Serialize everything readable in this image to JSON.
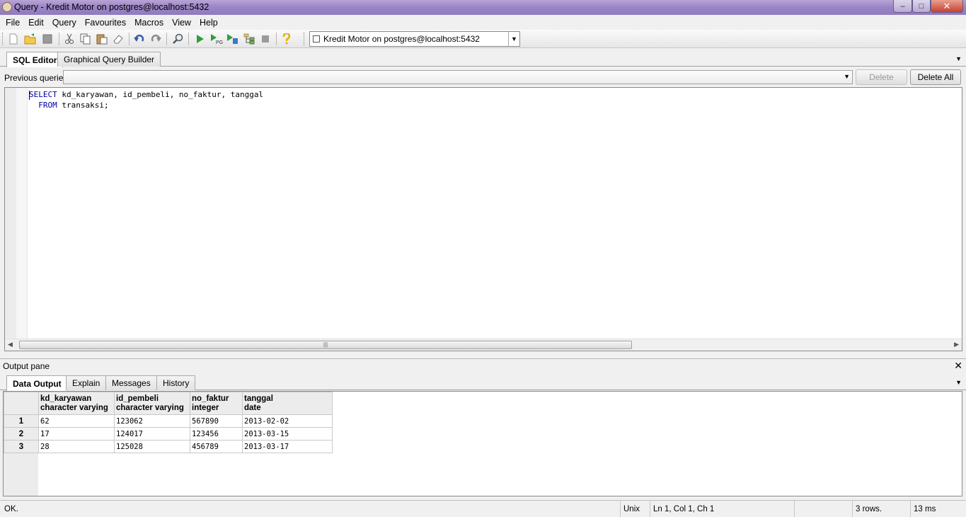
{
  "window": {
    "title": "Query - Kredit Motor on postgres@localhost:5432",
    "min_glyph": "–",
    "max_glyph": "□",
    "close_glyph": "✕"
  },
  "menu": [
    "File",
    "Edit",
    "Query",
    "Favourites",
    "Macros",
    "View",
    "Help"
  ],
  "toolbar": {
    "connection_value": "Kredit Motor on postgres@localhost:5432",
    "dropdown_arrow": "▼"
  },
  "editor_tabs": {
    "sql_editor": "SQL Editor",
    "graphical_query_builder": "Graphical Query Builder"
  },
  "previous_queries": {
    "label": "Previous queries",
    "value": "",
    "delete_label": "Delete",
    "delete_all_label": "Delete All"
  },
  "editor": {
    "line1_keyword": "SELECT",
    "line1_rest": " kd_karyawan, id_pembeli, no_faktur, tanggal",
    "line2_indent": "  ",
    "line2_keyword": "FROM",
    "line2_rest": " transaksi;",
    "scroll_grip": "|||"
  },
  "output": {
    "pane_label": "Output pane",
    "close_glyph": "✕",
    "tabs": {
      "data_output": "Data Output",
      "explain": "Explain",
      "messages": "Messages",
      "history": "History"
    },
    "columns": [
      {
        "name": "kd_karyawan",
        "type": "character varying"
      },
      {
        "name": "id_pembeli",
        "type": "character varying"
      },
      {
        "name": "no_faktur",
        "type": "integer"
      },
      {
        "name": "tanggal",
        "type": "date"
      }
    ],
    "rows": [
      {
        "num": "1",
        "cells": [
          "62",
          "123062",
          "567890",
          "2013-02-02"
        ]
      },
      {
        "num": "2",
        "cells": [
          "17",
          "124017",
          "123456",
          "2013-03-15"
        ]
      },
      {
        "num": "3",
        "cells": [
          "28",
          "125028",
          "456789",
          "2013-03-17"
        ]
      }
    ]
  },
  "status": {
    "message": "OK.",
    "line_ending": "Unix",
    "position": "Ln 1, Col 1, Ch 1",
    "rows": "3 rows.",
    "time": "13 ms"
  }
}
